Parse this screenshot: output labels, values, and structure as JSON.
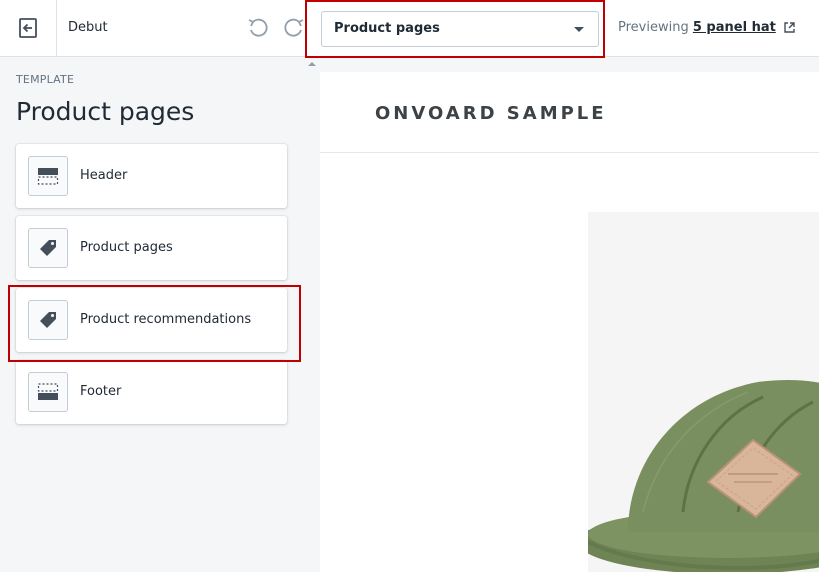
{
  "topbar": {
    "theme_name": "Debut",
    "template_select": {
      "selected": "Product pages"
    },
    "previewing_label": "Previewing",
    "preview_product": "5 panel hat"
  },
  "sidebar": {
    "eyebrow": "TEMPLATE",
    "title": "Product pages",
    "sections": [
      {
        "label": "Header",
        "icon": "header-layout-icon"
      },
      {
        "label": "Product pages",
        "icon": "tag-icon"
      },
      {
        "label": "Product recommendations",
        "icon": "tag-icon"
      },
      {
        "label": "Footer",
        "icon": "footer-layout-icon"
      }
    ]
  },
  "preview": {
    "store_name": "ONVOARD SAMPLE",
    "product_image": "green-5-panel-hat"
  },
  "colors": {
    "highlight": "#c00000",
    "sidebar_bg": "#f4f6f8",
    "border": "#dfe3e8",
    "text": "#212b36",
    "muted": "#637381",
    "hat_green": "#7a8f5f",
    "patch": "#d9b699"
  }
}
